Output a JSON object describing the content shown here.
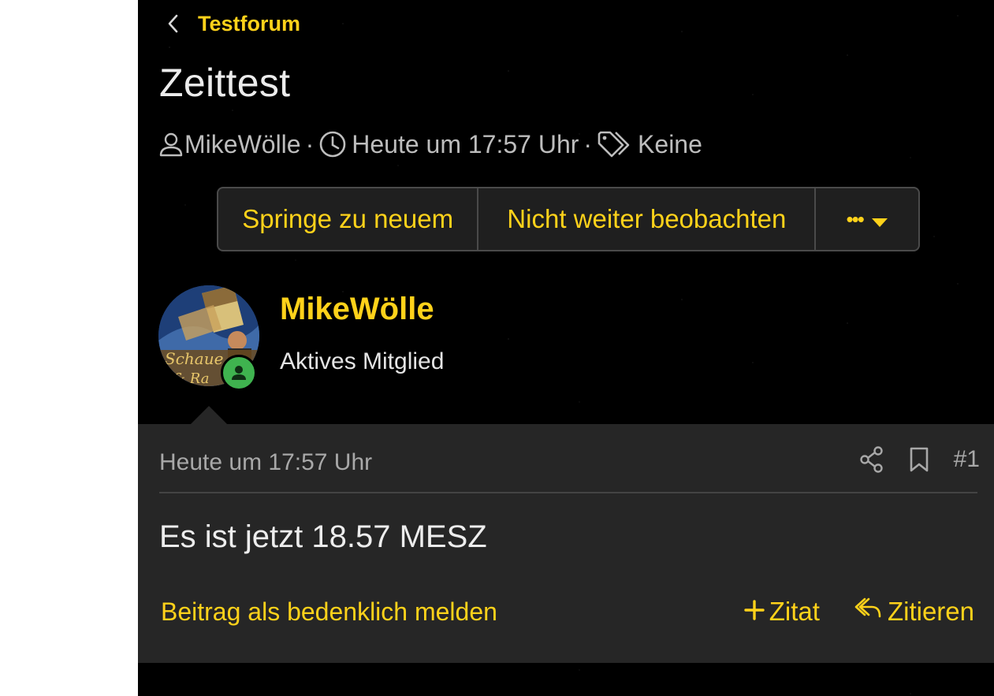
{
  "breadcrumb": {
    "label": "Testforum"
  },
  "thread": {
    "title": "Zeittest",
    "meta": {
      "author": "MikeWölle",
      "separator": "·",
      "date": "Heute um 17:57 Uhr",
      "tags": "Keine"
    }
  },
  "actions": {
    "jump_new": "Springe zu neuem",
    "unwatch": "Nicht weiter beobachten",
    "more": "•••"
  },
  "post": {
    "author": "MikeWölle",
    "role": "Aktives Mitglied",
    "avatar_text": [
      "Schaue",
      "& Ra"
    ],
    "time": "Heute um 17:57 Uhr",
    "number": "#1",
    "content": "Es ist jetzt 18.57 MESZ",
    "report": "Beitrag als bedenklich melden",
    "add_quote": "Zitat",
    "quote": "Zitieren"
  },
  "colors": {
    "accent": "#ffd21a",
    "background": "#000000",
    "post_bg": "#262626",
    "online": "#3fb34f"
  },
  "icons": [
    "chevron-left-icon",
    "user-icon",
    "clock-icon",
    "tag-icon",
    "caret-down-icon",
    "share-icon",
    "bookmark-icon",
    "plus-icon",
    "reply-icon",
    "online-user-icon"
  ]
}
